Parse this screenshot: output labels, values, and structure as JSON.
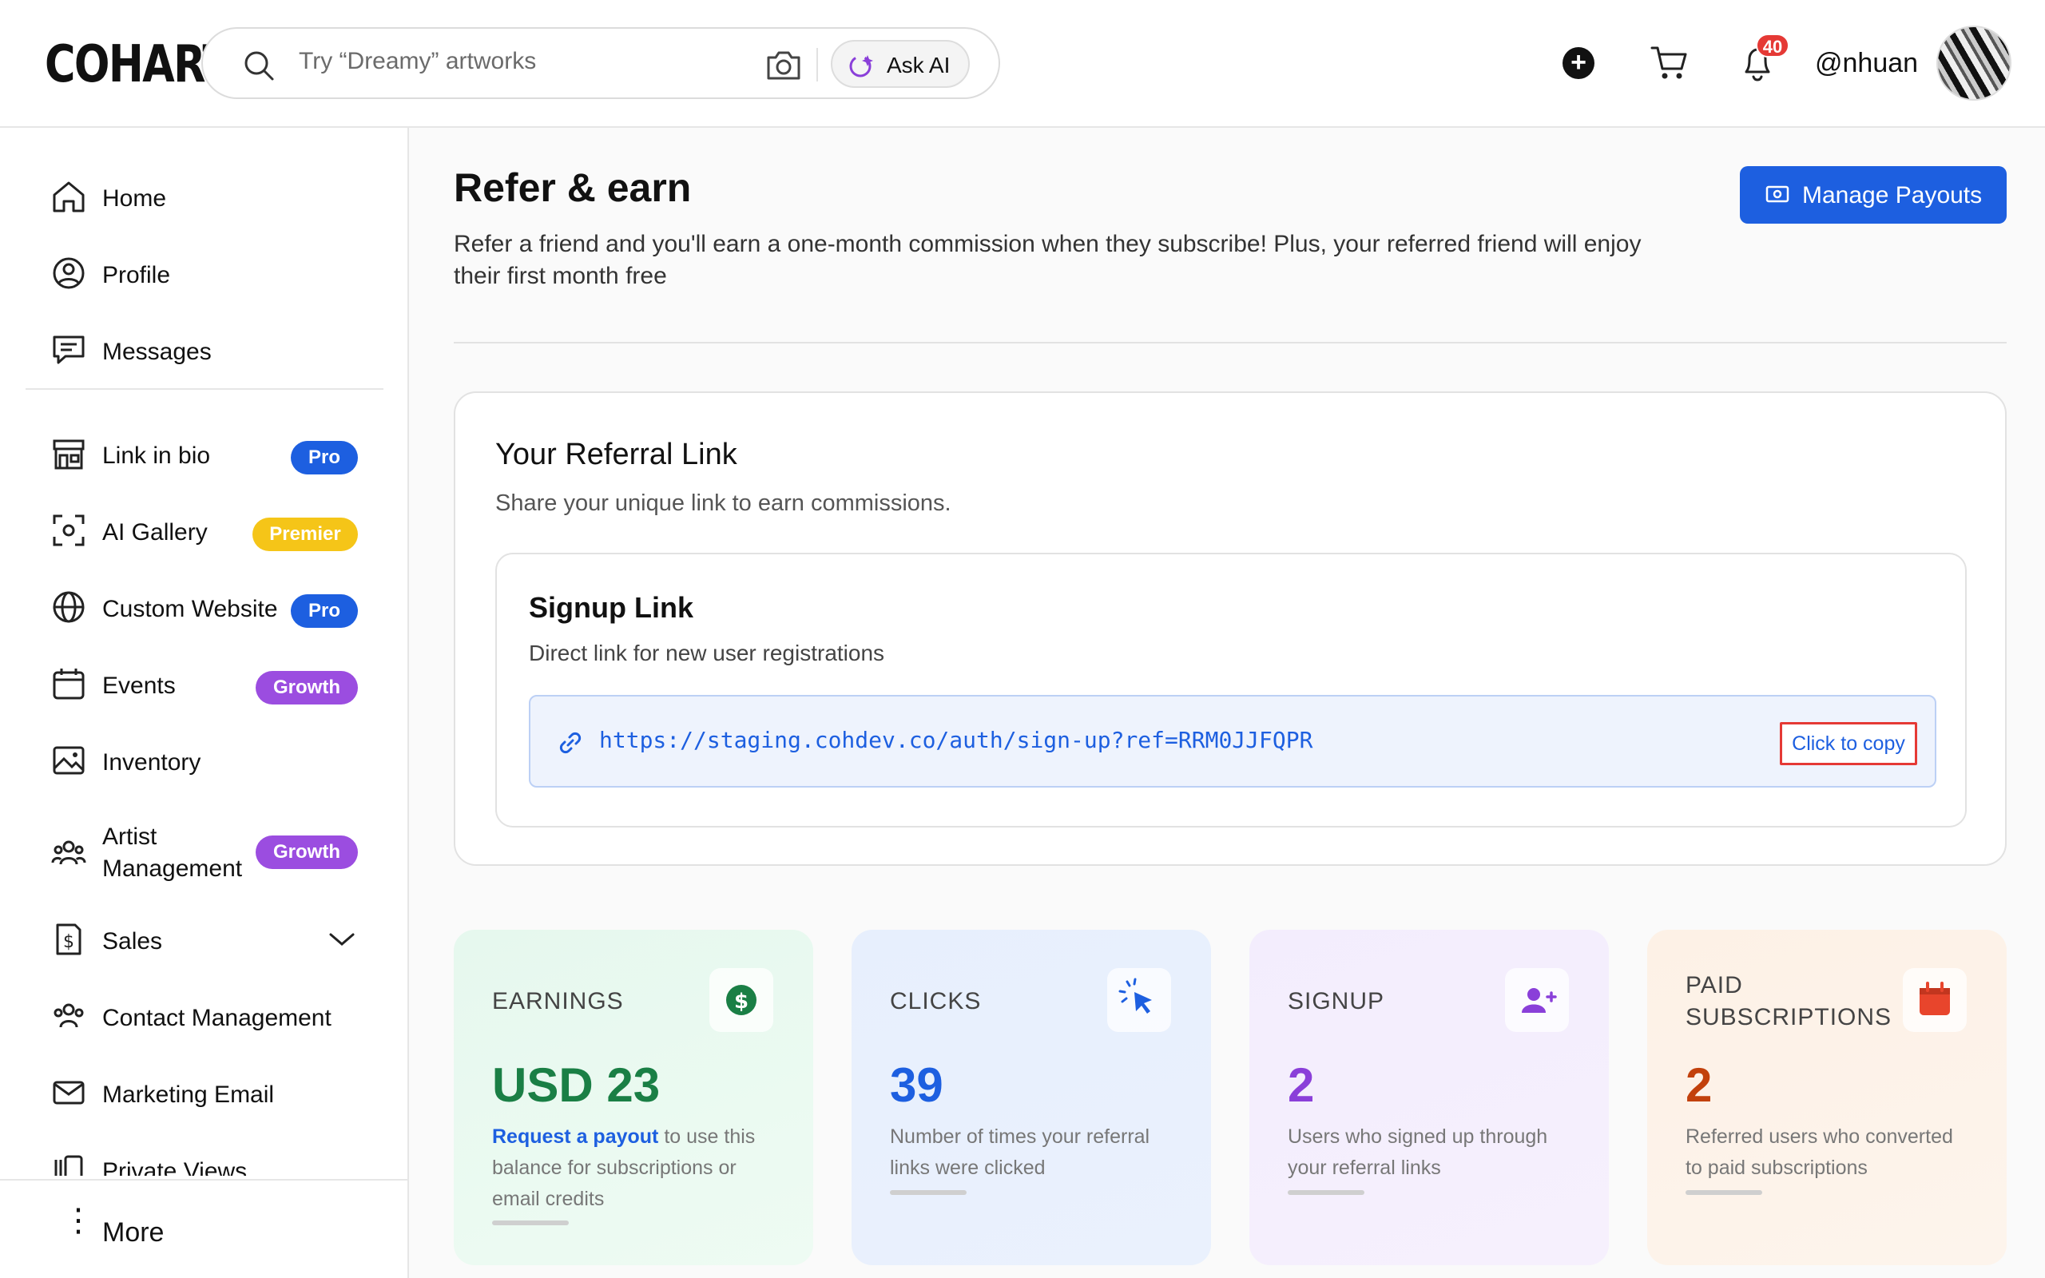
{
  "header": {
    "logo": "COHART",
    "search_placeholder": "Try “Dreamy” artworks",
    "ask_ai_label": "Ask AI",
    "notification_count": "40",
    "username": "@nhuan"
  },
  "sidebar": {
    "items": [
      {
        "label": "Home",
        "icon": "home-icon"
      },
      {
        "label": "Profile",
        "icon": "profile-icon"
      },
      {
        "label": "Messages",
        "icon": "messages-icon"
      },
      {
        "label": "Link in bio",
        "icon": "storefront-icon",
        "badge": "Pro"
      },
      {
        "label": "AI Gallery",
        "icon": "scan-icon",
        "badge": "Premier"
      },
      {
        "label": "Custom Website",
        "icon": "globe-icon",
        "badge": "Pro"
      },
      {
        "label": "Events",
        "icon": "calendar-icon",
        "badge": "Growth"
      },
      {
        "label": "Inventory",
        "icon": "image-icon"
      },
      {
        "label": "Artist Management",
        "icon": "people-icon",
        "badge": "Growth"
      },
      {
        "label": "Sales",
        "icon": "dollar-icon"
      },
      {
        "label": "Contact Management",
        "icon": "contacts-icon"
      },
      {
        "label": "Marketing Email",
        "icon": "mail-icon"
      },
      {
        "label": "Private Views",
        "icon": "private-views-icon"
      }
    ],
    "more_label": "More"
  },
  "main": {
    "title": "Refer & earn",
    "subtitle": "Refer a friend and you'll earn a one-month commission when they subscribe! Plus, your referred friend will enjoy their first month free",
    "manage_payouts_label": "Manage Payouts",
    "referral": {
      "title": "Your Referral Link",
      "subtitle": "Share your unique link to earn commissions.",
      "signup_title": "Signup Link",
      "signup_subtitle": "Direct link for new user registrations",
      "url": "https://staging.cohdev.co/auth/sign-up?ref=RRM0JJFQPR",
      "copy_label": "Click to copy"
    },
    "stats": [
      {
        "label": "EARNINGS",
        "value": "USD 23",
        "desc_link": "Request a payout",
        "desc": " to use this balance for subscriptions or email credits",
        "color": "#1a7f45"
      },
      {
        "label": "CLICKS",
        "value": "39",
        "desc": "Number of times your referral links were clicked",
        "color": "#1d5fe0"
      },
      {
        "label": "SIGNUP",
        "value": "2",
        "desc": "Users who signed up through your referral links",
        "color": "#8a3fd9"
      },
      {
        "label": "PAID SUBSCRIPTIONS",
        "value": "2",
        "desc": "Referred users who converted to paid subscriptions",
        "color": "#c2410c"
      }
    ]
  },
  "colors": {
    "accent": "#1d5fe0",
    "pro_badge": "#1d5fe0",
    "premier_badge": "#f5c518",
    "growth_badge": "#9b4de0",
    "notification": "#e53935",
    "highlight_border": "#e53935"
  }
}
